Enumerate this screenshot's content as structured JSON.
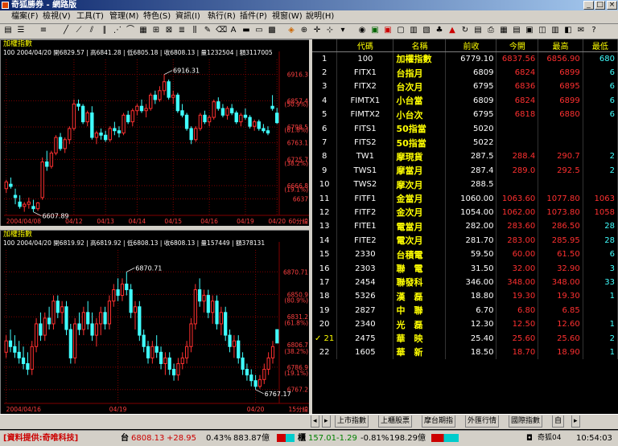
{
  "window": {
    "title": "奇狐勝券 - 網路版"
  },
  "menu": [
    "檔案(F)",
    "檢視(V)",
    "工具(T)",
    "管理(M)",
    "特色(S)",
    "資訊(I)",
    "執行(R)",
    "插件(P)",
    "視窗(W)",
    "說明(H)"
  ],
  "colors": {
    "up": "#ff3030",
    "down": "#40ffff",
    "flat": "#ffffff",
    "label": "#ffff00",
    "grid": "#800000"
  },
  "chart_data": [
    {
      "type": "candlestick",
      "title": "加權指數",
      "info": "100 2004/04/20 開6829.57 | 高6841.28 | 低6805.18 | 收6808.13 | 量1232504 | 額3117005",
      "period": "60分線",
      "ylim": [
        6600,
        6950
      ],
      "y_ticks": [
        {
          "v": 6916.3,
          "t": "6916.3"
        },
        {
          "v": 6857.4,
          "t": "6857.4"
        },
        {
          "v": 6850,
          "t": "(50.9%)"
        },
        {
          "v": 6798.5,
          "t": "6798.5"
        },
        {
          "v": 6792,
          "t": "(61.8%)"
        },
        {
          "v": 6763.1,
          "t": "6763.1"
        },
        {
          "v": 6725.7,
          "t": "6725.7"
        },
        {
          "v": 6717,
          "t": "(38.2%)"
        },
        {
          "v": 6666.8,
          "t": "6666.8"
        },
        {
          "v": 6659,
          "t": "(19.1%)"
        },
        {
          "v": 6637,
          "t": "6637"
        }
      ],
      "x_labels": [
        {
          "i": 0,
          "t": "2004/04/08"
        },
        {
          "i": 15,
          "t": "04/12"
        },
        {
          "i": 22,
          "t": "04/13"
        },
        {
          "i": 29,
          "t": "04/14"
        },
        {
          "i": 37,
          "t": "04/15"
        },
        {
          "i": 45,
          "t": "04/16"
        },
        {
          "i": 53,
          "t": "04/19"
        },
        {
          "i": 60,
          "t": "04/20"
        }
      ],
      "annotations": [
        {
          "i": 35,
          "v": 6916.31,
          "t": "6916.31"
        },
        {
          "i": 6,
          "v": 6607.89,
          "t": "6607.89"
        }
      ],
      "candles": [
        [
          6660,
          6680,
          6650,
          6675
        ],
        [
          6670,
          6685,
          6660,
          6665
        ],
        [
          6645,
          6660,
          6625,
          6640
        ],
        [
          6630,
          6645,
          6615,
          6620
        ],
        [
          6620,
          6630,
          6608,
          6625
        ],
        [
          6625,
          6640,
          6615,
          6630
        ],
        [
          6620,
          6635,
          6607.89,
          6615
        ],
        [
          6615,
          6630,
          6610,
          6628
        ],
        [
          6640,
          6730,
          6635,
          6720
        ],
        [
          6720,
          6745,
          6700,
          6710
        ],
        [
          6710,
          6745,
          6705,
          6740
        ],
        [
          6740,
          6780,
          6735,
          6775
        ],
        [
          6775,
          6785,
          6745,
          6750
        ],
        [
          6750,
          6775,
          6740,
          6770
        ],
        [
          6770,
          6800,
          6760,
          6795
        ],
        [
          6795,
          6860,
          6790,
          6850
        ],
        [
          6850,
          6860,
          6835,
          6845
        ],
        [
          6845,
          6850,
          6805,
          6810
        ],
        [
          6810,
          6835,
          6800,
          6830
        ],
        [
          6830,
          6845,
          6770,
          6775
        ],
        [
          6775,
          6790,
          6760,
          6785
        ],
        [
          6785,
          6795,
          6770,
          6780
        ],
        [
          6780,
          6790,
          6765,
          6770
        ],
        [
          6770,
          6800,
          6765,
          6795
        ],
        [
          6795,
          6810,
          6780,
          6790
        ],
        [
          6790,
          6800,
          6775,
          6785
        ],
        [
          6785,
          6830,
          6780,
          6825
        ],
        [
          6825,
          6835,
          6805,
          6810
        ],
        [
          6810,
          6840,
          6800,
          6835
        ],
        [
          6835,
          6850,
          6825,
          6845
        ],
        [
          6845,
          6860,
          6830,
          6835
        ],
        [
          6835,
          6850,
          6820,
          6840
        ],
        [
          6840,
          6875,
          6835,
          6870
        ],
        [
          6870,
          6880,
          6850,
          6860
        ],
        [
          6860,
          6890,
          6855,
          6880
        ],
        [
          6880,
          6916.31,
          6870,
          6900
        ],
        [
          6900,
          6905,
          6860,
          6865
        ],
        [
          6865,
          6880,
          6850,
          6870
        ],
        [
          6870,
          6875,
          6830,
          6835
        ],
        [
          6835,
          6850,
          6820,
          6825
        ],
        [
          6825,
          6830,
          6790,
          6795
        ],
        [
          6795,
          6800,
          6760,
          6770
        ],
        [
          6770,
          6800,
          6765,
          6795
        ],
        [
          6795,
          6830,
          6790,
          6825
        ],
        [
          6825,
          6835,
          6805,
          6810
        ],
        [
          6810,
          6825,
          6800,
          6820
        ],
        [
          6820,
          6860,
          6815,
          6855
        ],
        [
          6855,
          6865,
          6835,
          6840
        ],
        [
          6840,
          6850,
          6820,
          6825
        ],
        [
          6825,
          6845,
          6815,
          6840
        ],
        [
          6840,
          6850,
          6825,
          6830
        ],
        [
          6830,
          6835,
          6805,
          6810
        ],
        [
          6810,
          6830,
          6800,
          6825
        ],
        [
          6825,
          6840,
          6815,
          6820
        ],
        [
          6820,
          6825,
          6795,
          6800
        ],
        [
          6800,
          6815,
          6790,
          6810
        ],
        [
          6810,
          6815,
          6790,
          6795
        ],
        [
          6795,
          6805,
          6785,
          6790
        ],
        [
          6790,
          6800,
          6780,
          6785
        ],
        [
          6845,
          6870,
          6835,
          6840
        ],
        [
          6829.57,
          6841.28,
          6805.18,
          6808.13
        ]
      ]
    },
    {
      "type": "candlestick",
      "title": "加權指數",
      "info": "100 2004/04/20 開6819.92 | 高6819.92 | 低6808.13 | 收6808.13 | 量157449 | 額378131",
      "period": "15分線",
      "ylim": [
        6755,
        6890
      ],
      "y_ticks": [
        {
          "v": 6870.7,
          "t": "6870.71"
        },
        {
          "v": 6850.9,
          "t": "6850.9"
        },
        {
          "v": 6846,
          "t": "(80.9%)"
        },
        {
          "v": 6831.2,
          "t": "6831.2"
        },
        {
          "v": 6826,
          "t": "(61.8%)"
        },
        {
          "v": 6806.7,
          "t": "6806.7"
        },
        {
          "v": 6801,
          "t": "(38.2%)"
        },
        {
          "v": 6786.9,
          "t": "6786.9"
        },
        {
          "v": 6782,
          "t": "(19.1%)"
        },
        {
          "v": 6767.2,
          "t": "6767.2"
        }
      ],
      "x_labels": [
        {
          "i": 0,
          "t": "2004/04/16"
        },
        {
          "i": 26,
          "t": "04/19"
        },
        {
          "i": 58,
          "t": "04/20"
        }
      ],
      "annotations": [
        {
          "i": 28,
          "v": 6870.71,
          "t": "6870.71"
        },
        {
          "i": 58,
          "v": 6767.17,
          "t": "6767.17"
        }
      ],
      "candles": [
        [
          6800,
          6815,
          6795,
          6810
        ],
        [
          6810,
          6820,
          6800,
          6805
        ],
        [
          6805,
          6815,
          6795,
          6800
        ],
        [
          6800,
          6810,
          6790,
          6795
        ],
        [
          6795,
          6805,
          6785,
          6790
        ],
        [
          6790,
          6800,
          6780,
          6785
        ],
        [
          6785,
          6810,
          6780,
          6805
        ],
        [
          6805,
          6830,
          6800,
          6825
        ],
        [
          6825,
          6835,
          6810,
          6815
        ],
        [
          6815,
          6835,
          6810,
          6830
        ],
        [
          6830,
          6840,
          6820,
          6825
        ],
        [
          6825,
          6850,
          6820,
          6845
        ],
        [
          6845,
          6850,
          6830,
          6835
        ],
        [
          6835,
          6845,
          6825,
          6840
        ],
        [
          6840,
          6845,
          6815,
          6820
        ],
        [
          6820,
          6825,
          6790,
          6795
        ],
        [
          6795,
          6830,
          6790,
          6825
        ],
        [
          6825,
          6835,
          6815,
          6820
        ],
        [
          6820,
          6840,
          6815,
          6835
        ],
        [
          6835,
          6845,
          6820,
          6825
        ],
        [
          6825,
          6835,
          6810,
          6815
        ],
        [
          6815,
          6830,
          6805,
          6825
        ],
        [
          6825,
          6840,
          6815,
          6835
        ],
        [
          6835,
          6840,
          6820,
          6825
        ],
        [
          6825,
          6850,
          6820,
          6845
        ],
        [
          6845,
          6860,
          6840,
          6855
        ],
        [
          6855,
          6865,
          6845,
          6850
        ],
        [
          6850,
          6865,
          6845,
          6860
        ],
        [
          6860,
          6870.71,
          6850,
          6855
        ],
        [
          6855,
          6860,
          6830,
          6835
        ],
        [
          6835,
          6845,
          6820,
          6840
        ],
        [
          6840,
          6845,
          6810,
          6815
        ],
        [
          6815,
          6820,
          6800,
          6805
        ],
        [
          6805,
          6810,
          6790,
          6795
        ],
        [
          6795,
          6810,
          6790,
          6805
        ],
        [
          6805,
          6815,
          6795,
          6800
        ],
        [
          6800,
          6805,
          6785,
          6790
        ],
        [
          6790,
          6800,
          6780,
          6795
        ],
        [
          6795,
          6800,
          6780,
          6785
        ],
        [
          6785,
          6790,
          6775,
          6780
        ],
        [
          6780,
          6795,
          6775,
          6790
        ],
        [
          6790,
          6800,
          6785,
          6795
        ],
        [
          6795,
          6810,
          6790,
          6805
        ],
        [
          6805,
          6830,
          6800,
          6825
        ],
        [
          6825,
          6860,
          6820,
          6855
        ],
        [
          6855,
          6865,
          6840,
          6845
        ],
        [
          6845,
          6855,
          6835,
          6850
        ],
        [
          6850,
          6855,
          6830,
          6835
        ],
        [
          6835,
          6850,
          6825,
          6845
        ],
        [
          6845,
          6850,
          6820,
          6825
        ],
        [
          6825,
          6840,
          6815,
          6835
        ],
        [
          6835,
          6840,
          6810,
          6815
        ],
        [
          6815,
          6820,
          6800,
          6805
        ],
        [
          6805,
          6815,
          6795,
          6810
        ],
        [
          6810,
          6815,
          6790,
          6795
        ],
        [
          6795,
          6800,
          6780,
          6785
        ],
        [
          6785,
          6790,
          6775,
          6780
        ],
        [
          6780,
          6785,
          6770,
          6775
        ],
        [
          6775,
          6780,
          6767.17,
          6770
        ],
        [
          6770,
          6780,
          6768,
          6776
        ],
        [
          6776,
          6790,
          6772,
          6785
        ],
        [
          6785,
          6800,
          6780,
          6795
        ],
        [
          6795,
          6810,
          6790,
          6805
        ],
        [
          6819.92,
          6819.92,
          6808.13,
          6808.13
        ]
      ]
    }
  ],
  "quote": {
    "headers": [
      "",
      "代碼",
      "名稱",
      "前收",
      "今開",
      "最高",
      "最低"
    ],
    "rows": [
      {
        "no": "1",
        "code": "100",
        "name": "加權指數",
        "prev": "6779.10",
        "open": "6837.56",
        "high": "6856.90",
        "low": "680"
      },
      {
        "no": "2",
        "code": "FITX1",
        "name": "台指月",
        "prev": "6809",
        "open": "6824",
        "high": "6899",
        "low": "6"
      },
      {
        "no": "3",
        "code": "FITX2",
        "name": "台次月",
        "prev": "6795",
        "open": "6836",
        "high": "6895",
        "low": "6"
      },
      {
        "no": "4",
        "code": "FIMTX1",
        "name": "小台當",
        "prev": "6809",
        "open": "6824",
        "high": "6899",
        "low": "6"
      },
      {
        "no": "5",
        "code": "FIMTX2",
        "name": "小台次",
        "prev": "6795",
        "open": "6818",
        "high": "6880",
        "low": "6"
      },
      {
        "no": "6",
        "code": "FITS1",
        "name": "50指當",
        "prev": "5020",
        "open": "",
        "high": "",
        "low": ""
      },
      {
        "no": "7",
        "code": "FITS2",
        "name": "50指當",
        "prev": "5022",
        "open": "",
        "high": "",
        "low": ""
      },
      {
        "no": "8",
        "code": "TW1",
        "name": "摩現貨",
        "prev": "287.5",
        "open": "288.4",
        "high": "290.7",
        "low": "2"
      },
      {
        "no": "9",
        "code": "TWS1",
        "name": "摩當月",
        "prev": "287.4",
        "open": "289.0",
        "high": "292.5",
        "low": "2"
      },
      {
        "no": "10",
        "code": "TWS2",
        "name": "摩次月",
        "prev": "288.5",
        "open": "",
        "high": "",
        "low": ""
      },
      {
        "no": "11",
        "code": "FITF1",
        "name": "金當月",
        "prev": "1060.00",
        "open": "1063.60",
        "high": "1077.80",
        "low": "1063"
      },
      {
        "no": "12",
        "code": "FITF2",
        "name": "金次月",
        "prev": "1054.00",
        "open": "1062.00",
        "high": "1073.80",
        "low": "1058"
      },
      {
        "no": "13",
        "code": "FITE1",
        "name": "電當月",
        "prev": "282.00",
        "open": "283.60",
        "high": "286.50",
        "low": "28"
      },
      {
        "no": "14",
        "code": "FITE2",
        "name": "電次月",
        "prev": "281.70",
        "open": "283.00",
        "high": "285.95",
        "low": "28"
      },
      {
        "no": "15",
        "code": "2330",
        "name": "台積電",
        "prev": "59.50",
        "open": "60.00",
        "high": "61.50",
        "low": "6"
      },
      {
        "no": "16",
        "code": "2303",
        "name": "聯　電",
        "prev": "31.50",
        "open": "32.00",
        "high": "32.90",
        "low": "3"
      },
      {
        "no": "17",
        "code": "2454",
        "name": "聯發科",
        "prev": "346.00",
        "open": "348.00",
        "high": "348.00",
        "low": "33"
      },
      {
        "no": "18",
        "code": "5326",
        "name": "漢　磊",
        "prev": "18.80",
        "open": "19.30",
        "high": "19.30",
        "low": "1"
      },
      {
        "no": "19",
        "code": "2827",
        "name": "中　聯",
        "prev": "6.70",
        "open": "6.80",
        "high": "6.85",
        "low": ""
      },
      {
        "no": "20",
        "code": "2340",
        "name": "光　磊",
        "prev": "12.30",
        "open": "12.50",
        "high": "12.60",
        "low": "1"
      },
      {
        "no": "21",
        "code": "2475",
        "name": "華　映",
        "prev": "25.40",
        "open": "25.60",
        "high": "25.60",
        "low": "2"
      },
      {
        "no": "22",
        "code": "1605",
        "name": "華　新",
        "prev": "18.50",
        "open": "18.70",
        "high": "18.90",
        "low": "1"
      }
    ]
  },
  "tabs": [
    "上市指數",
    "上櫃股票",
    "摩台期指",
    "外匯行情",
    "國際指數",
    "自"
  ],
  "status": {
    "provider": "[資料提供:奇唯科技]",
    "tw_label": "台",
    "tw_value": "6808.13",
    "tw_change": "+28.95",
    "tw_pct": "0.43%",
    "tw_amount": "883.87億",
    "otc_label": "櫃",
    "otc_value": "157.01",
    "otc_change": "-1.29",
    "otc_pct": "-0.81%",
    "otc_amount": "198.29億",
    "clock_user": "奇狐04",
    "time": "10:54:03"
  }
}
